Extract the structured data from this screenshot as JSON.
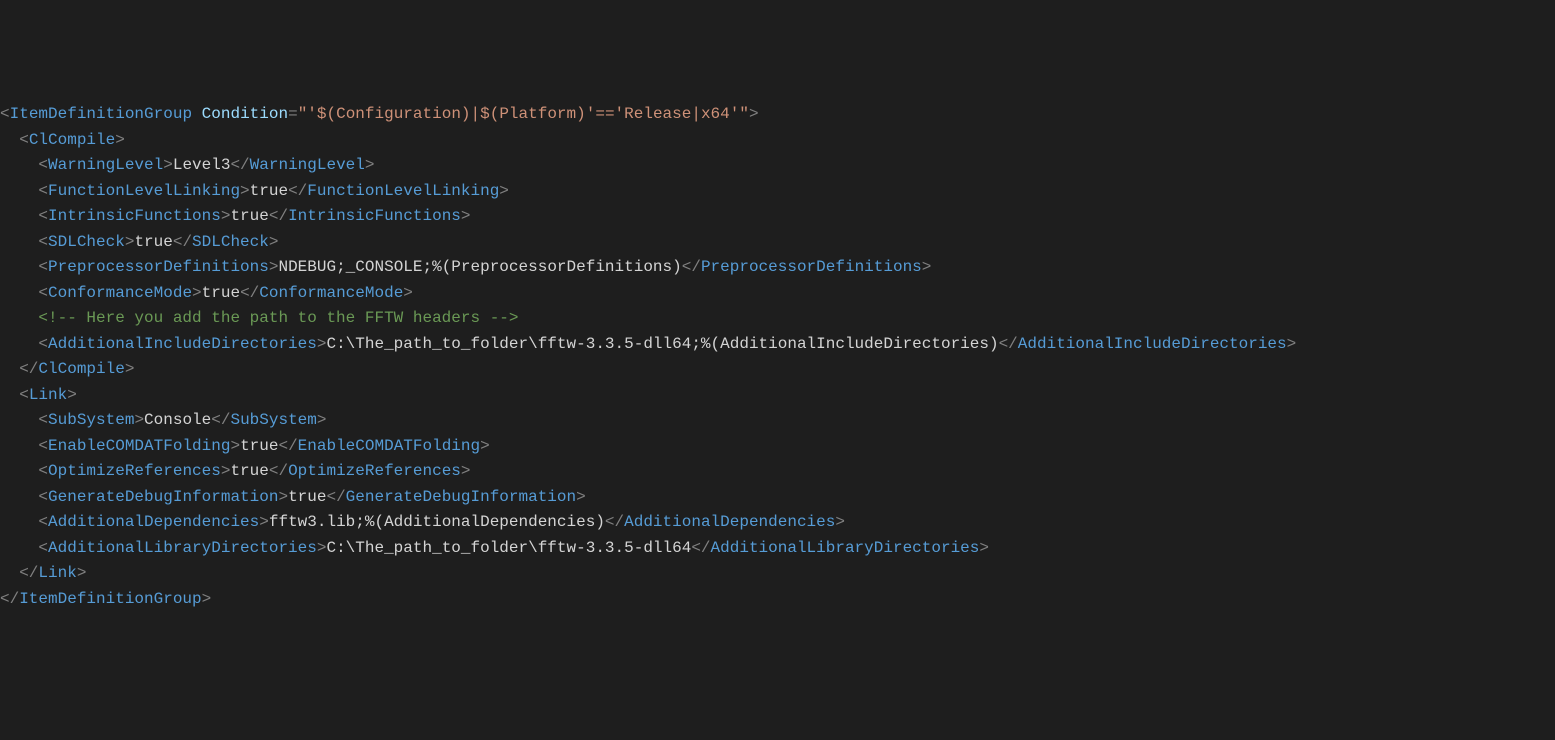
{
  "lines": [
    {
      "indent": 0,
      "parts": [
        {
          "c": "bracket",
          "t": "<"
        },
        {
          "c": "tag",
          "t": "ItemDefinitionGroup"
        },
        {
          "c": "text",
          "t": " "
        },
        {
          "c": "attr-name",
          "t": "Condition"
        },
        {
          "c": "bracket",
          "t": "="
        },
        {
          "c": "attr-value",
          "t": "\"'$(Configuration)|$(Platform)'=='Release|x64'\""
        },
        {
          "c": "bracket",
          "t": ">"
        }
      ]
    },
    {
      "indent": 2,
      "parts": [
        {
          "c": "bracket",
          "t": "<"
        },
        {
          "c": "tag",
          "t": "ClCompile"
        },
        {
          "c": "bracket",
          "t": ">"
        }
      ]
    },
    {
      "indent": 4,
      "parts": [
        {
          "c": "bracket",
          "t": "<"
        },
        {
          "c": "tag",
          "t": "WarningLevel"
        },
        {
          "c": "bracket",
          "t": ">"
        },
        {
          "c": "text",
          "t": "Level3"
        },
        {
          "c": "bracket",
          "t": "</"
        },
        {
          "c": "tag",
          "t": "WarningLevel"
        },
        {
          "c": "bracket",
          "t": ">"
        }
      ]
    },
    {
      "indent": 4,
      "parts": [
        {
          "c": "bracket",
          "t": "<"
        },
        {
          "c": "tag",
          "t": "FunctionLevelLinking"
        },
        {
          "c": "bracket",
          "t": ">"
        },
        {
          "c": "text",
          "t": "true"
        },
        {
          "c": "bracket",
          "t": "</"
        },
        {
          "c": "tag",
          "t": "FunctionLevelLinking"
        },
        {
          "c": "bracket",
          "t": ">"
        }
      ]
    },
    {
      "indent": 4,
      "parts": [
        {
          "c": "bracket",
          "t": "<"
        },
        {
          "c": "tag",
          "t": "IntrinsicFunctions"
        },
        {
          "c": "bracket",
          "t": ">"
        },
        {
          "c": "text",
          "t": "true"
        },
        {
          "c": "bracket",
          "t": "</"
        },
        {
          "c": "tag",
          "t": "IntrinsicFunctions"
        },
        {
          "c": "bracket",
          "t": ">"
        }
      ]
    },
    {
      "indent": 4,
      "parts": [
        {
          "c": "bracket",
          "t": "<"
        },
        {
          "c": "tag",
          "t": "SDLCheck"
        },
        {
          "c": "bracket",
          "t": ">"
        },
        {
          "c": "text",
          "t": "true"
        },
        {
          "c": "bracket",
          "t": "</"
        },
        {
          "c": "tag",
          "t": "SDLCheck"
        },
        {
          "c": "bracket",
          "t": ">"
        }
      ]
    },
    {
      "indent": 4,
      "parts": [
        {
          "c": "bracket",
          "t": "<"
        },
        {
          "c": "tag",
          "t": "PreprocessorDefinitions"
        },
        {
          "c": "bracket",
          "t": ">"
        },
        {
          "c": "text",
          "t": "NDEBUG;_CONSOLE;%(PreprocessorDefinitions)"
        },
        {
          "c": "bracket",
          "t": "</"
        },
        {
          "c": "tag",
          "t": "PreprocessorDefinitions"
        },
        {
          "c": "bracket",
          "t": ">"
        }
      ]
    },
    {
      "indent": 4,
      "parts": [
        {
          "c": "bracket",
          "t": "<"
        },
        {
          "c": "tag",
          "t": "ConformanceMode"
        },
        {
          "c": "bracket",
          "t": ">"
        },
        {
          "c": "text",
          "t": "true"
        },
        {
          "c": "bracket",
          "t": "</"
        },
        {
          "c": "tag",
          "t": "ConformanceMode"
        },
        {
          "c": "bracket",
          "t": ">"
        }
      ]
    },
    {
      "indent": 4,
      "parts": [
        {
          "c": "comment-delim",
          "t": "<!--"
        },
        {
          "c": "comment",
          "t": " Here you add the path to the FFTW headers "
        },
        {
          "c": "comment-delim",
          "t": "-->"
        }
      ]
    },
    {
      "indent": 4,
      "parts": [
        {
          "c": "bracket",
          "t": "<"
        },
        {
          "c": "tag",
          "t": "AdditionalIncludeDirectories"
        },
        {
          "c": "bracket",
          "t": ">"
        },
        {
          "c": "text",
          "t": "C:\\The_path_to_folder\\fftw-3.3.5-dll64;%(AdditionalIncludeDirectories)"
        },
        {
          "c": "bracket",
          "t": "</"
        },
        {
          "c": "tag",
          "t": "AdditionalIncludeDirectories"
        },
        {
          "c": "bracket",
          "t": ">"
        }
      ]
    },
    {
      "indent": 2,
      "parts": [
        {
          "c": "bracket",
          "t": "</"
        },
        {
          "c": "tag",
          "t": "ClCompile"
        },
        {
          "c": "bracket",
          "t": ">"
        }
      ]
    },
    {
      "indent": 2,
      "parts": [
        {
          "c": "bracket",
          "t": "<"
        },
        {
          "c": "tag",
          "t": "Link"
        },
        {
          "c": "bracket",
          "t": ">"
        }
      ]
    },
    {
      "indent": 4,
      "parts": [
        {
          "c": "bracket",
          "t": "<"
        },
        {
          "c": "tag",
          "t": "SubSystem"
        },
        {
          "c": "bracket",
          "t": ">"
        },
        {
          "c": "text",
          "t": "Console"
        },
        {
          "c": "bracket",
          "t": "</"
        },
        {
          "c": "tag",
          "t": "SubSystem"
        },
        {
          "c": "bracket",
          "t": ">"
        }
      ]
    },
    {
      "indent": 4,
      "parts": [
        {
          "c": "bracket",
          "t": "<"
        },
        {
          "c": "tag",
          "t": "EnableCOMDATFolding"
        },
        {
          "c": "bracket",
          "t": ">"
        },
        {
          "c": "text",
          "t": "true"
        },
        {
          "c": "bracket",
          "t": "</"
        },
        {
          "c": "tag",
          "t": "EnableCOMDATFolding"
        },
        {
          "c": "bracket",
          "t": ">"
        }
      ]
    },
    {
      "indent": 4,
      "parts": [
        {
          "c": "bracket",
          "t": "<"
        },
        {
          "c": "tag",
          "t": "OptimizeReferences"
        },
        {
          "c": "bracket",
          "t": ">"
        },
        {
          "c": "text",
          "t": "true"
        },
        {
          "c": "bracket",
          "t": "</"
        },
        {
          "c": "tag",
          "t": "OptimizeReferences"
        },
        {
          "c": "bracket",
          "t": ">"
        }
      ]
    },
    {
      "indent": 4,
      "parts": [
        {
          "c": "bracket",
          "t": "<"
        },
        {
          "c": "tag",
          "t": "GenerateDebugInformation"
        },
        {
          "c": "bracket",
          "t": ">"
        },
        {
          "c": "text",
          "t": "true"
        },
        {
          "c": "bracket",
          "t": "</"
        },
        {
          "c": "tag",
          "t": "GenerateDebugInformation"
        },
        {
          "c": "bracket",
          "t": ">"
        }
      ]
    },
    {
      "indent": 4,
      "parts": [
        {
          "c": "bracket",
          "t": "<"
        },
        {
          "c": "tag",
          "t": "AdditionalDependencies"
        },
        {
          "c": "bracket",
          "t": ">"
        },
        {
          "c": "text",
          "t": "fftw3.lib;%(AdditionalDependencies)"
        },
        {
          "c": "bracket",
          "t": "</"
        },
        {
          "c": "tag",
          "t": "AdditionalDependencies"
        },
        {
          "c": "bracket",
          "t": ">"
        }
      ]
    },
    {
      "indent": 4,
      "parts": [
        {
          "c": "bracket",
          "t": "<"
        },
        {
          "c": "tag",
          "t": "AdditionalLibraryDirectories"
        },
        {
          "c": "bracket",
          "t": ">"
        },
        {
          "c": "text",
          "t": "C:\\The_path_to_folder\\fftw-3.3.5-dll64"
        },
        {
          "c": "bracket",
          "t": "</"
        },
        {
          "c": "tag",
          "t": "AdditionalLibraryDirectories"
        },
        {
          "c": "bracket",
          "t": ">"
        }
      ]
    },
    {
      "indent": 2,
      "parts": [
        {
          "c": "bracket",
          "t": "</"
        },
        {
          "c": "tag",
          "t": "Link"
        },
        {
          "c": "bracket",
          "t": ">"
        }
      ]
    },
    {
      "indent": 0,
      "parts": [
        {
          "c": "bracket",
          "t": "</"
        },
        {
          "c": "tag",
          "t": "ItemDefinitionGroup"
        },
        {
          "c": "bracket",
          "t": ">"
        }
      ]
    }
  ]
}
